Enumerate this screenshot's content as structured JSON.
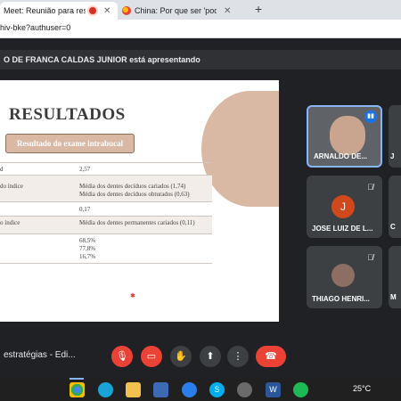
{
  "browser": {
    "tabs": [
      {
        "label": "Meet: Reunião para resultad",
        "active": true
      },
      {
        "label": "China: Por que ser 'podre de ric",
        "active": false
      }
    ],
    "url": "hiv-bke?authuser=0"
  },
  "presenting": {
    "text": "O DE FRANCA CALDAS JUNIOR está apresentando"
  },
  "slide": {
    "title": "RESULTADOS",
    "subtitle": "Resultado do exame intrabucal",
    "rows": [
      {
        "left": "d",
        "right": [
          "2,57"
        ]
      },
      {
        "left": "do índice",
        "right": [
          "Média dos dentes decíduos cariados (1,74)",
          "Média dos dentes decíduos obturados (0,63)"
        ]
      },
      {
        "left": "",
        "right": [
          "0,17"
        ]
      },
      {
        "left": "o índice",
        "right": [
          "Média dos dentes permanentes cariados (0,11)"
        ]
      },
      {
        "left": "",
        "right": [
          "68,5%",
          "77,8%",
          "16,7%"
        ]
      }
    ]
  },
  "participants": [
    {
      "name": "ARNALDO DE...",
      "type": "video",
      "speaking": true
    },
    {
      "name": "JOSE LUIZ DE L...",
      "type": "avatar",
      "initial": "J",
      "muted": true
    },
    {
      "name": "THIAGO HENRI...",
      "type": "photo",
      "muted": true
    }
  ],
  "partial_participants": [
    "J",
    "C",
    "M"
  ],
  "controls": {
    "meeting_name": "estratégias - Edi..."
  },
  "taskbar": {
    "temperature": "25°C"
  },
  "colors": {
    "accent": "#d9b8a4",
    "danger": "#ea4335",
    "meet_bg": "#202124"
  }
}
